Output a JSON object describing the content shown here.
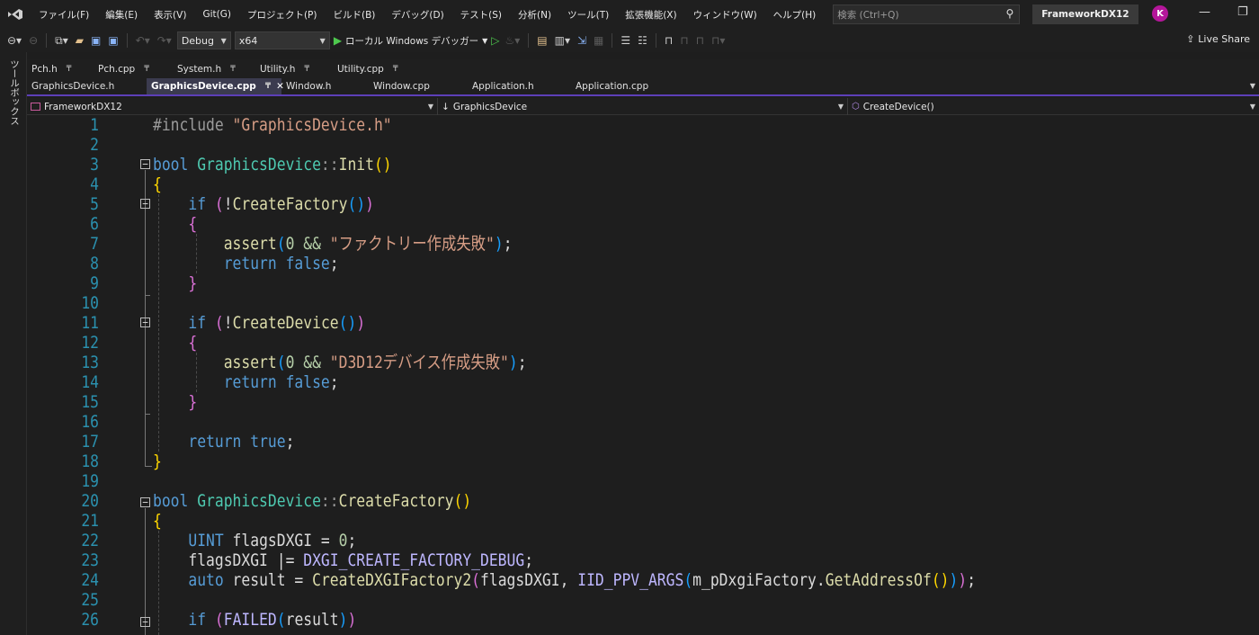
{
  "menubar": {
    "logo": "VS",
    "items": [
      "ファイル(F)",
      "編集(E)",
      "表示(V)",
      "Git(G)",
      "プロジェクト(P)",
      "ビルド(B)",
      "デバッグ(D)",
      "テスト(S)",
      "分析(N)",
      "ツール(T)",
      "拡張機能(X)",
      "ウィンドウ(W)",
      "ヘルプ(H)"
    ],
    "search_placeholder": "検索 (Ctrl+Q)",
    "solution": "FrameworkDX12",
    "avatar_initial": "K"
  },
  "toolbar": {
    "configuration": "Debug",
    "platform": "x64",
    "run_label": "ローカル Windows デバッガー",
    "live_share": "Live Share"
  },
  "toolbox_label": "ツールボックス",
  "tabs": {
    "pinned": [
      "Pch.h",
      "Pch.cpp",
      "System.h",
      "Utility.h",
      "Utility.cpp"
    ],
    "open": [
      "GraphicsDevice.h",
      "GraphicsDevice.cpp",
      "Window.h",
      "Window.cpp",
      "Application.h",
      "Application.cpp"
    ],
    "active": "GraphicsDevice.cpp"
  },
  "navbar": {
    "project": "FrameworkDX12",
    "scope": "GraphicsDevice",
    "member": "CreateDevice()"
  },
  "editor": {
    "line_numbers": [
      "1",
      "2",
      "3",
      "4",
      "5",
      "6",
      "7",
      "8",
      "9",
      "10",
      "11",
      "12",
      "13",
      "14",
      "15",
      "16",
      "17",
      "18",
      "19",
      "20",
      "21",
      "22",
      "23",
      "24",
      "25",
      "26"
    ],
    "code": {
      "l1_a": "#include ",
      "l1_b": "\"GraphicsDevice.h\"",
      "l3_a": "bool ",
      "l3_b": "GraphicsDevice",
      "l3_c": "::",
      "l3_d": "Init",
      "l3_e": "()",
      "l4": "{",
      "l5_a": "if ",
      "l5_b": "(",
      "l5_c": "!",
      "l5_d": "CreateFactory",
      "l5_e": "()",
      "l5_f": ")",
      "l6": "{",
      "l7_a": "assert",
      "l7_b": "(",
      "l7_c": "0 && ",
      "l7_d": "\"ファクトリー作成失敗\"",
      "l7_e": ")",
      "l7_f": ";",
      "l8_a": "return ",
      "l8_b": "false",
      "l8_c": ";",
      "l9": "}",
      "l11_a": "if ",
      "l11_b": "(",
      "l11_c": "!",
      "l11_d": "CreateDevice",
      "l11_e": "()",
      "l11_f": ")",
      "l12": "{",
      "l13_a": "assert",
      "l13_b": "(",
      "l13_c": "0 && ",
      "l13_d": "\"D3D12デバイス作成失敗\"",
      "l13_e": ")",
      "l13_f": ";",
      "l14_a": "return ",
      "l14_b": "false",
      "l14_c": ";",
      "l15": "}",
      "l17_a": "return ",
      "l17_b": "true",
      "l17_c": ";",
      "l18": "}",
      "l20_a": "bool ",
      "l20_b": "GraphicsDevice",
      "l20_c": "::",
      "l20_d": "CreateFactory",
      "l20_e": "()",
      "l21": "{",
      "l22_a": "UINT ",
      "l22_b": "flagsDXGI",
      "l22_c": " = ",
      "l22_d": "0",
      "l22_e": ";",
      "l23_a": "flagsDXGI",
      "l23_b": " |= ",
      "l23_c": "DXGI_CREATE_FACTORY_DEBUG",
      "l23_d": ";",
      "l24_a": "auto ",
      "l24_b": "result",
      "l24_c": " = ",
      "l24_d": "CreateDXGIFactory2",
      "l24_e": "(",
      "l24_f": "flagsDXGI",
      "l24_g": ", ",
      "l24_h": "IID_PPV_ARGS",
      "l24_i": "(",
      "l24_j": "m_pDxgiFactory",
      "l24_k": ".",
      "l24_l": "GetAddressOf",
      "l24_m": "()",
      "l24_n": ")",
      "l24_o": ")",
      "l24_p": ";",
      "l26_a": "if ",
      "l26_b": "(",
      "l26_c": "FAILED",
      "l26_d": "(",
      "l26_e": "result",
      "l26_f": ")",
      "l26_g": ")"
    }
  }
}
